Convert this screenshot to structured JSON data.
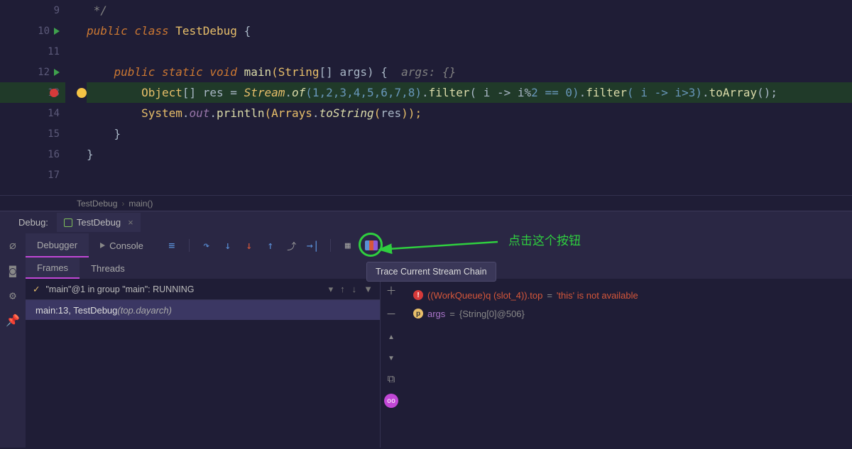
{
  "lines": {
    "l9": {
      "num": "9"
    },
    "l10": {
      "num": "10"
    },
    "l11": {
      "num": "11"
    },
    "l12": {
      "num": "12"
    },
    "l13": {
      "num": "13"
    },
    "l14": {
      "num": "14"
    },
    "l15": {
      "num": "15"
    },
    "l16": {
      "num": "16"
    },
    "l17": {
      "num": "17"
    }
  },
  "code": {
    "l9_cm": " */",
    "l10_public": "public ",
    "l10_class": "class ",
    "l10_name": "TestDebug ",
    "l10_brace": "{",
    "l12_public": "public ",
    "l12_static": "static ",
    "l12_void": "void ",
    "l12_main": "main",
    "l12_open": "(",
    "l12_String": "String",
    "l12_brk": "[] ",
    "l12_args": "args",
    "l12_close": ") {  ",
    "l12_hint": "args: {}",
    "l13_Object": "Object",
    "l13_brk": "[] ",
    "l13_res": "res ",
    "l13_eq": "= ",
    "l13_Stream": "Stream",
    "l13_dot1": ".",
    "l13_of": "of",
    "l13_args": "(1,2,3,4,5,6,7,8)",
    "l13_dot2": ".",
    "l13_filter1": "filter",
    "l13_f1a": "( i -> i",
    "l13_mod": "%",
    "l13_f1b": "2 == 0)",
    "l13_dot3": ".",
    "l13_filter2": "filter",
    "l13_f2": "( i -> i>3)",
    "l13_dot4": ".",
    "l13_toArray": "toArray",
    "l13_end": "();",
    "l14_Sys": "System",
    "l14_dot1": ".",
    "l14_out": "out",
    "l14_dot2": ".",
    "l14_println": "println",
    "l14_open": "(",
    "l14_Arrays": "Arrays",
    "l14_dot3": ".",
    "l14_toString": "toString",
    "l14_open2": "(",
    "l14_res": "res",
    "l14_close": "));",
    "l15_brace": "}",
    "l16_brace": "}"
  },
  "breadcrumb": {
    "a": "TestDebug",
    "b": "main()"
  },
  "debugHeader": {
    "label": "Debug:",
    "tab": "TestDebug"
  },
  "dbgTabs": {
    "debugger": "Debugger",
    "console": "Console"
  },
  "tooltip": "Trace Current Stream Chain",
  "annotation": "点击这个按钮",
  "framesTabs": {
    "frames": "Frames",
    "threads": "Threads"
  },
  "threadSel": "\"main\"@1 in group \"main\": RUNNING",
  "frameRow": {
    "a": "main:13, TestDebug ",
    "b": "(top.dayarch)"
  },
  "vars": {
    "err": {
      "a": "((WorkQueue)q (slot_4)).top",
      "b": " = ",
      "c": "'this' is not available"
    },
    "args": {
      "a": "args",
      "b": " = ",
      "c": "{String[0]@506}"
    }
  }
}
